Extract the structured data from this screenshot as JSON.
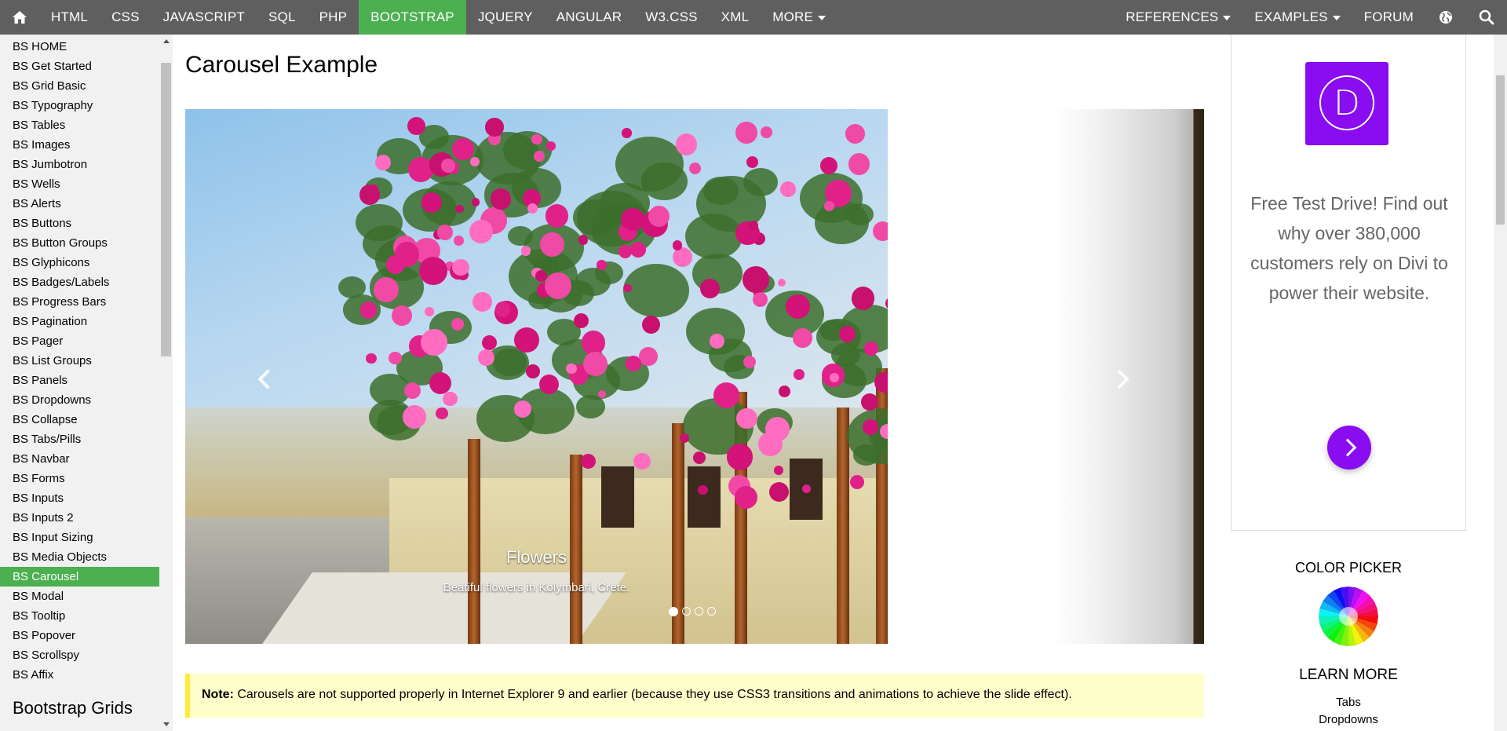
{
  "topnav": {
    "items": [
      "HTML",
      "CSS",
      "JAVASCRIPT",
      "SQL",
      "PHP",
      "BOOTSTRAP",
      "JQUERY",
      "ANGULAR",
      "W3.CSS",
      "XML",
      "MORE"
    ],
    "active_item": "BOOTSTRAP",
    "right_items": [
      "REFERENCES",
      "EXAMPLES",
      "FORUM"
    ],
    "active_color": "#4caf50",
    "bar_color": "#5f5f5f",
    "icons": [
      "home-icon",
      "globe-icon",
      "search-icon"
    ]
  },
  "sidebar": {
    "items": [
      "BS HOME",
      "BS Get Started",
      "BS Grid Basic",
      "BS Typography",
      "BS Tables",
      "BS Images",
      "BS Jumbotron",
      "BS Wells",
      "BS Alerts",
      "BS Buttons",
      "BS Button Groups",
      "BS Glyphicons",
      "BS Badges/Labels",
      "BS Progress Bars",
      "BS Pagination",
      "BS Pager",
      "BS List Groups",
      "BS Panels",
      "BS Dropdowns",
      "BS Collapse",
      "BS Tabs/Pills",
      "BS Navbar",
      "BS Forms",
      "BS Inputs",
      "BS Inputs 2",
      "BS Input Sizing",
      "BS Media Objects",
      "BS Carousel",
      "BS Modal",
      "BS Tooltip",
      "BS Popover",
      "BS Scrollspy",
      "BS Affix"
    ],
    "active_item": "BS Carousel",
    "section_title": "Bootstrap Grids"
  },
  "main": {
    "title": "Carousel Example",
    "carousel": {
      "caption_title": "Flowers",
      "caption_text": "Beatiful flowers in Kolymbari, Crete.",
      "indicator_count": 4,
      "active_indicator": 0
    },
    "note": {
      "label": "Note:",
      "text": " Carousels are not supported properly in Internet Explorer 9 and earlier (because they use CSS3 transitions and animations to achieve the slide effect)."
    }
  },
  "ad": {
    "logo_letter": "D",
    "text": "Free Test Drive! Find out why over 380,000 customers rely on Divi to power their website.",
    "brand_color": "#8a0cf0"
  },
  "right_panel": {
    "color_picker_title": "COLOR PICKER",
    "learn_more_title": "LEARN MORE",
    "learn_more_links": [
      "Tabs",
      "Dropdowns"
    ]
  }
}
